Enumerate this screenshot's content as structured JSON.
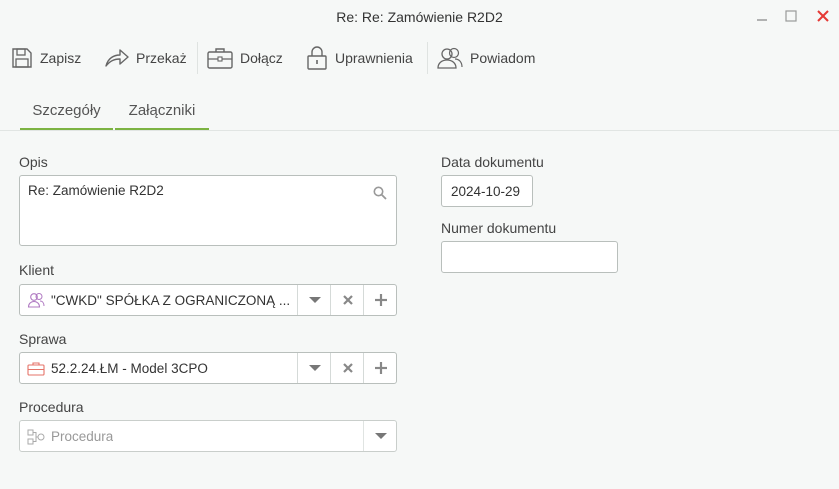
{
  "window": {
    "title": "Re: Re: Zamówienie R2D2",
    "minimize_icon": "minimize-icon",
    "maximize_icon": "maximize-icon",
    "close_icon": "close-icon",
    "close_color": "#e53935"
  },
  "toolbar": {
    "save": {
      "label": "Zapisz",
      "icon": "save-icon"
    },
    "forward": {
      "label": "Przekaż",
      "icon": "forward-icon"
    },
    "attach": {
      "label": "Dołącz",
      "icon": "briefcase-icon"
    },
    "permissions": {
      "label": "Uprawnienia",
      "icon": "lock-icon"
    },
    "notify": {
      "label": "Powiadom",
      "icon": "users-icon"
    }
  },
  "tabs": [
    {
      "label": "Szczegóły",
      "active": true
    },
    {
      "label": "Załączniki",
      "active": false
    }
  ],
  "accent_color": "#7cb342",
  "form": {
    "opis": {
      "label": "Opis",
      "value": "Re: Zamówienie R2D2",
      "icon": "search-icon"
    },
    "klient": {
      "label": "Klient",
      "value": "\"CWKD\" SPÓŁKA Z OGRANICZONĄ ...",
      "icon": "client-icon"
    },
    "sprawa": {
      "label": "Sprawa",
      "value": "52.2.24.ŁM - Model 3CPO",
      "icon": "case-icon"
    },
    "procedura": {
      "label": "Procedura",
      "placeholder": "Procedura",
      "icon": "procedure-icon"
    },
    "data_dokumentu": {
      "label": "Data dokumentu",
      "value": "2024-10-29"
    },
    "numer_dokumentu": {
      "label": "Numer dokumentu",
      "value": ""
    }
  }
}
